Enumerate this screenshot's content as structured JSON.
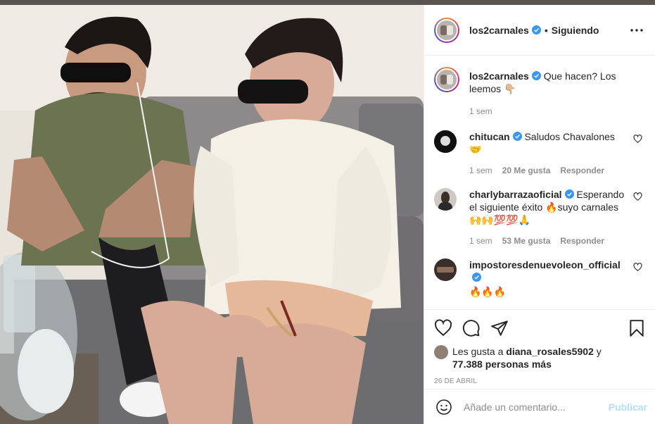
{
  "colors": {
    "verified": "#3897f0",
    "link": "#0095f6",
    "publish_disabled": "#b2dffc",
    "muted": "#8e8e8e",
    "flame": "#ff6b1a"
  },
  "post": {
    "username": "los2carnales",
    "follow_status": "Siguiendo",
    "more_icon": "more-horizontal-icon"
  },
  "caption": {
    "username": "los2carnales",
    "text": "Que hacen? Los leemos 👇🏼",
    "time": "1 sem"
  },
  "comments": [
    {
      "username": "chitucan",
      "text": "Saludos Chavalones 🤝",
      "time": "1 sem",
      "likes": "20 Me gusta",
      "reply": "Responder"
    },
    {
      "username": "charlybarrazaoficial",
      "text": "Esperando el siguiente éxito 🔥suyo carnales 🙌🙌💯💯🙏",
      "time": "1 sem",
      "likes": "53 Me gusta",
      "reply": "Responder"
    },
    {
      "username": "impostoresdenuevoleon_official",
      "text": "🔥🔥🔥",
      "time": "",
      "likes": "",
      "reply": ""
    }
  ],
  "likes": {
    "prefix": "Les gusta a",
    "user": "diana_rosales5902",
    "connector": "y",
    "others": "77.388 personas más"
  },
  "date": "26 DE ABRIL",
  "add_comment": {
    "placeholder": "Añade un comentario...",
    "publish": "Publicar"
  }
}
